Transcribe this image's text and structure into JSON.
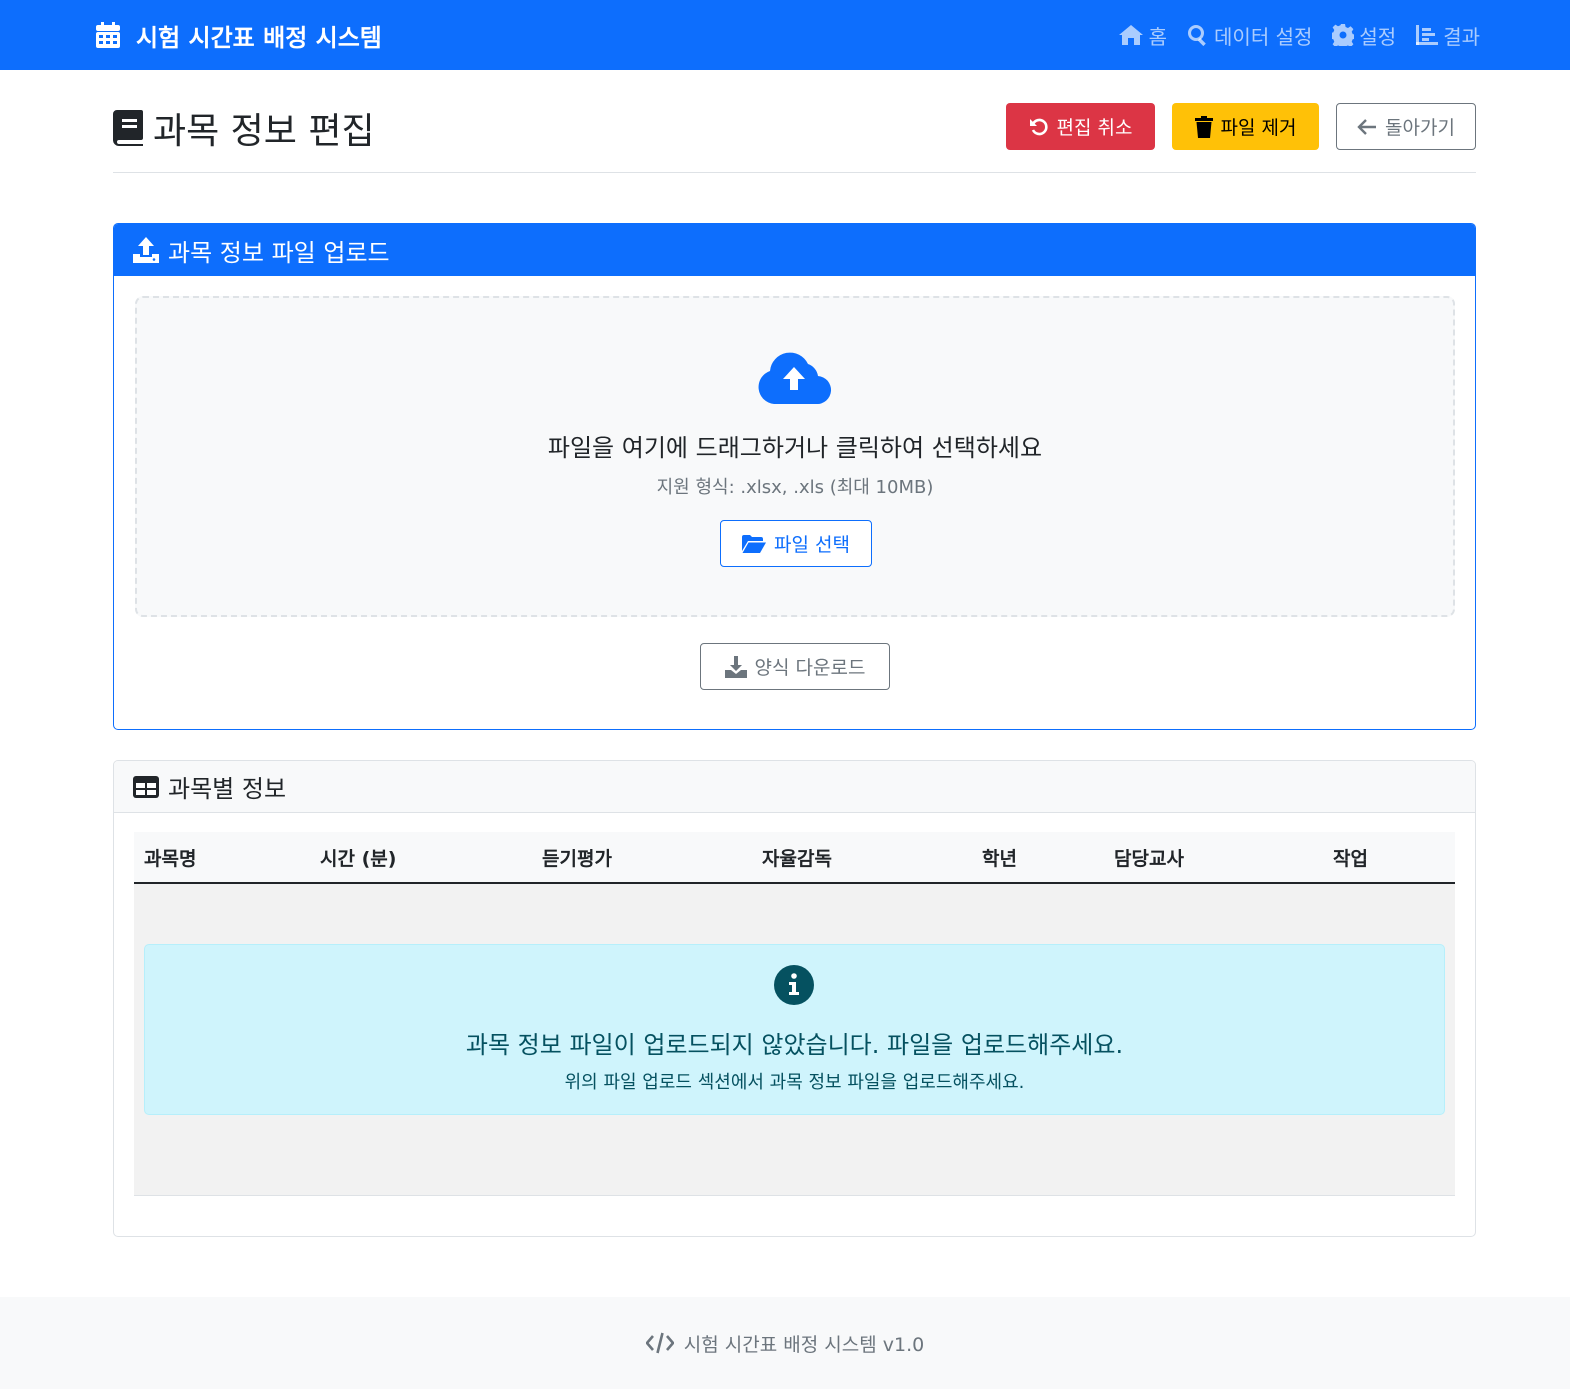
{
  "navbar": {
    "brand": "시험 시간표 배정 시스템",
    "links": [
      {
        "label": "홈",
        "icon": "home-icon"
      },
      {
        "label": "데이터 설정",
        "icon": "search-icon"
      },
      {
        "label": "설정",
        "icon": "gear-icon"
      },
      {
        "label": "결과",
        "icon": "chart-icon"
      }
    ]
  },
  "header": {
    "title": "과목 정보 편집",
    "cancel_label": "편집 취소",
    "remove_label": "파일 제거",
    "back_label": "돌아가기"
  },
  "upload": {
    "title": "과목 정보 파일 업로드",
    "drop_text": "파일을 여기에 드래그하거나 클릭하여 선택하세요",
    "formats_text": "지원 형식: .xlsx, .xls (최대 10MB)",
    "select_label": "파일 선택",
    "template_label": "양식 다운로드"
  },
  "subjects": {
    "title": "과목별 정보",
    "columns": [
      "과목명",
      "시간 (분)",
      "듣기평가",
      "자율감독",
      "학년",
      "담당교사",
      "작업"
    ],
    "empty_title": "과목 정보 파일이 업로드되지 않았습니다. 파일을 업로드해주세요.",
    "empty_sub": "위의 파일 업로드 섹션에서 과목 정보 파일을 업로드해주세요."
  },
  "footer": {
    "text": "시험 시간표 배정 시스템 v1.0"
  },
  "colors": {
    "primary": "#0d6efd",
    "danger": "#dc3545",
    "warning": "#ffc107",
    "info_bg": "#cff4fc",
    "info_text": "#055160"
  }
}
